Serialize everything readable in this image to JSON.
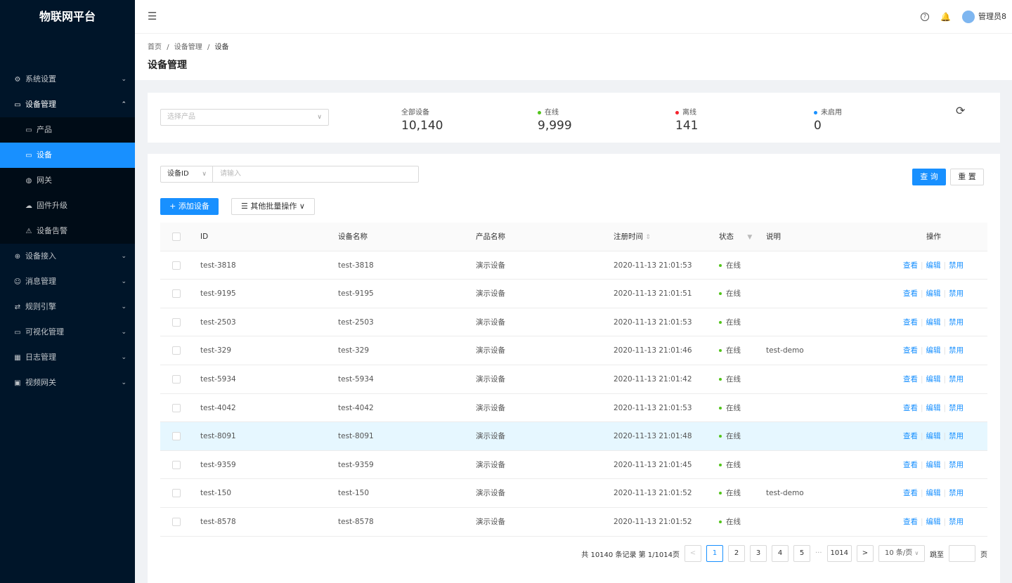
{
  "app_title": "物联网平台",
  "sidebar": {
    "items": [
      {
        "icon": "⚙",
        "label": "系统设置"
      },
      {
        "icon": "▭",
        "label": "设备管理",
        "children": [
          {
            "icon": "▭",
            "label": "产品"
          },
          {
            "icon": "▭",
            "label": "设备"
          },
          {
            "icon": "◍",
            "label": "网关"
          },
          {
            "icon": "☁",
            "label": "固件升级"
          },
          {
            "icon": "⚠",
            "label": "设备告警"
          }
        ]
      },
      {
        "icon": "⊕",
        "label": "设备接入"
      },
      {
        "icon": "☺",
        "label": "消息管理"
      },
      {
        "icon": "⇄",
        "label": "规则引擎"
      },
      {
        "icon": "▭",
        "label": "可视化管理"
      },
      {
        "icon": "▦",
        "label": "日志管理"
      },
      {
        "icon": "▣",
        "label": "视频网关"
      }
    ]
  },
  "topbar": {
    "user": "管理员8",
    "help_icon": "?",
    "bell_icon": "🔔"
  },
  "breadcrumb": [
    "首页",
    "设备管理",
    "设备"
  ],
  "breadcrumb_sep": "/",
  "page_title": "设备管理",
  "product_select": {
    "placeholder": "选择产品"
  },
  "stats": [
    {
      "label": "全部设备",
      "value": "10,140",
      "color": ""
    },
    {
      "label": "在线",
      "value": "9,999",
      "color": "#52c41a"
    },
    {
      "label": "离线",
      "value": "141",
      "color": "#f5222d"
    },
    {
      "label": "未启用",
      "value": "0",
      "color": "#1890ff"
    }
  ],
  "filter": {
    "field": "设备ID",
    "placeholder": "请输入"
  },
  "buttons": {
    "query": "查 询",
    "reset": "重 置",
    "add": "+ 添加设备",
    "batch": "☰ 其他批量操作 ∨"
  },
  "table": {
    "headers": {
      "id": "ID",
      "name": "设备名称",
      "product": "产品名称",
      "time": "注册时间",
      "status": "状态",
      "desc": "说明",
      "ops": "操作"
    },
    "rows": [
      {
        "id": "test-3818",
        "name": "test-3818",
        "product": "演示设备",
        "time": "2020-11-13 21:01:53",
        "status": "在线",
        "desc": ""
      },
      {
        "id": "test-9195",
        "name": "test-9195",
        "product": "演示设备",
        "time": "2020-11-13 21:01:51",
        "status": "在线",
        "desc": ""
      },
      {
        "id": "test-2503",
        "name": "test-2503",
        "product": "演示设备",
        "time": "2020-11-13 21:01:53",
        "status": "在线",
        "desc": ""
      },
      {
        "id": "test-329",
        "name": "test-329",
        "product": "演示设备",
        "time": "2020-11-13 21:01:46",
        "status": "在线",
        "desc": "test-demo"
      },
      {
        "id": "test-5934",
        "name": "test-5934",
        "product": "演示设备",
        "time": "2020-11-13 21:01:42",
        "status": "在线",
        "desc": ""
      },
      {
        "id": "test-4042",
        "name": "test-4042",
        "product": "演示设备",
        "time": "2020-11-13 21:01:53",
        "status": "在线",
        "desc": ""
      },
      {
        "id": "test-8091",
        "name": "test-8091",
        "product": "演示设备",
        "time": "2020-11-13 21:01:48",
        "status": "在线",
        "desc": ""
      },
      {
        "id": "test-9359",
        "name": "test-9359",
        "product": "演示设备",
        "time": "2020-11-13 21:01:45",
        "status": "在线",
        "desc": ""
      },
      {
        "id": "test-150",
        "name": "test-150",
        "product": "演示设备",
        "time": "2020-11-13 21:01:52",
        "status": "在线",
        "desc": "test-demo"
      },
      {
        "id": "test-8578",
        "name": "test-8578",
        "product": "演示设备",
        "time": "2020-11-13 21:01:52",
        "status": "在线",
        "desc": ""
      }
    ],
    "ops": [
      "查看",
      "编辑",
      "禁用"
    ]
  },
  "pagination": {
    "total_text": "共 10140 条记录 第 1/1014页",
    "pages": [
      "1",
      "2",
      "3",
      "4",
      "5",
      "···",
      "1014"
    ],
    "prev": "<",
    "next": ">",
    "size": "10 条/页",
    "jump_label": "跳至",
    "page_suffix": "页"
  }
}
